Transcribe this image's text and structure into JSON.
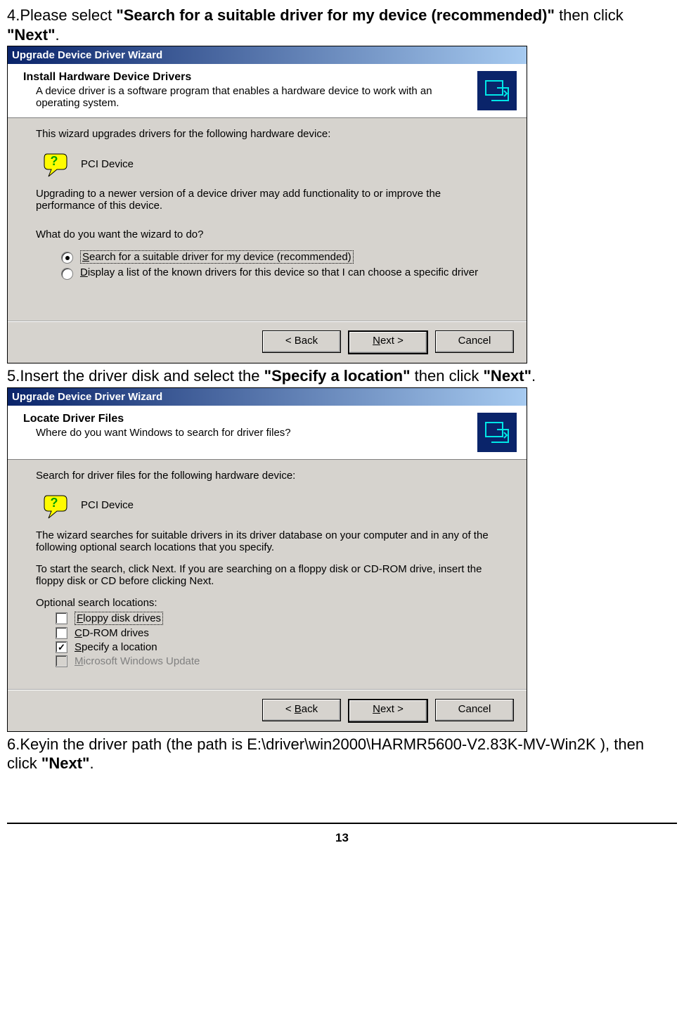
{
  "page_number": "13",
  "step4": {
    "prefix": "4.Please select ",
    "bold1": "\"Search for a suitable driver for my device (recommended)\"",
    "mid": "   then click ",
    "bold2": "\"Next\"",
    "suffix": "."
  },
  "step5": {
    "prefix": "5.Insert the driver disk and select the ",
    "bold1": "\"Specify a location\"",
    "mid": " then click ",
    "bold2": "\"Next\"",
    "suffix": "."
  },
  "step6": {
    "prefix": "6.Keyin the driver path (the path is E:\\driver\\win2000\\HARMR5600-V2.83K-MV-Win2K ), then click ",
    "bold1": "\"Next\"",
    "suffix": "."
  },
  "dlg1": {
    "title": "Upgrade Device Driver Wizard",
    "hdr_title": "Install Hardware Device Drivers",
    "hdr_sub": "A device driver is a software program that enables a hardware device to work with an operating system.",
    "line1": "This wizard upgrades drivers for the following hardware device:",
    "device": "PCI Device",
    "line2": "Upgrading to a newer version of a device driver may add functionality to or improve the performance of this device.",
    "question": "What do you want the wizard to do?",
    "opt1_pre": "S",
    "opt1": "earch for a suitable driver for my device (recommended)",
    "opt2_pre": "D",
    "opt2": "isplay a list of the known drivers for this device so that I can choose a specific driver",
    "back": "< Back",
    "next_pre": "N",
    "next": "ext >",
    "cancel": "Cancel"
  },
  "dlg2": {
    "title": "Upgrade Device Driver Wizard",
    "hdr_title": "Locate Driver Files",
    "hdr_sub": "Where do you want Windows to search for driver files?",
    "line1": "Search for driver files for the following hardware device:",
    "device": "PCI Device",
    "line2": "The wizard searches for suitable drivers in its driver database on your computer and in any of the following optional search locations that you specify.",
    "line3": "To start the search, click Next. If you are searching on a floppy disk or CD-ROM drive, insert the floppy disk or CD before clicking Next.",
    "optlabel": "Optional search locations:",
    "c1_pre": "F",
    "c1": "loppy disk drives",
    "c2_pre": "C",
    "c2": "D-ROM drives",
    "c3_pre": "S",
    "c3": "pecify a location",
    "c4_pre": "M",
    "c4": "icrosoft Windows Update",
    "back_pre": "B",
    "back": "ack",
    "next_pre": "N",
    "next": "ext >",
    "cancel": "Cancel"
  }
}
